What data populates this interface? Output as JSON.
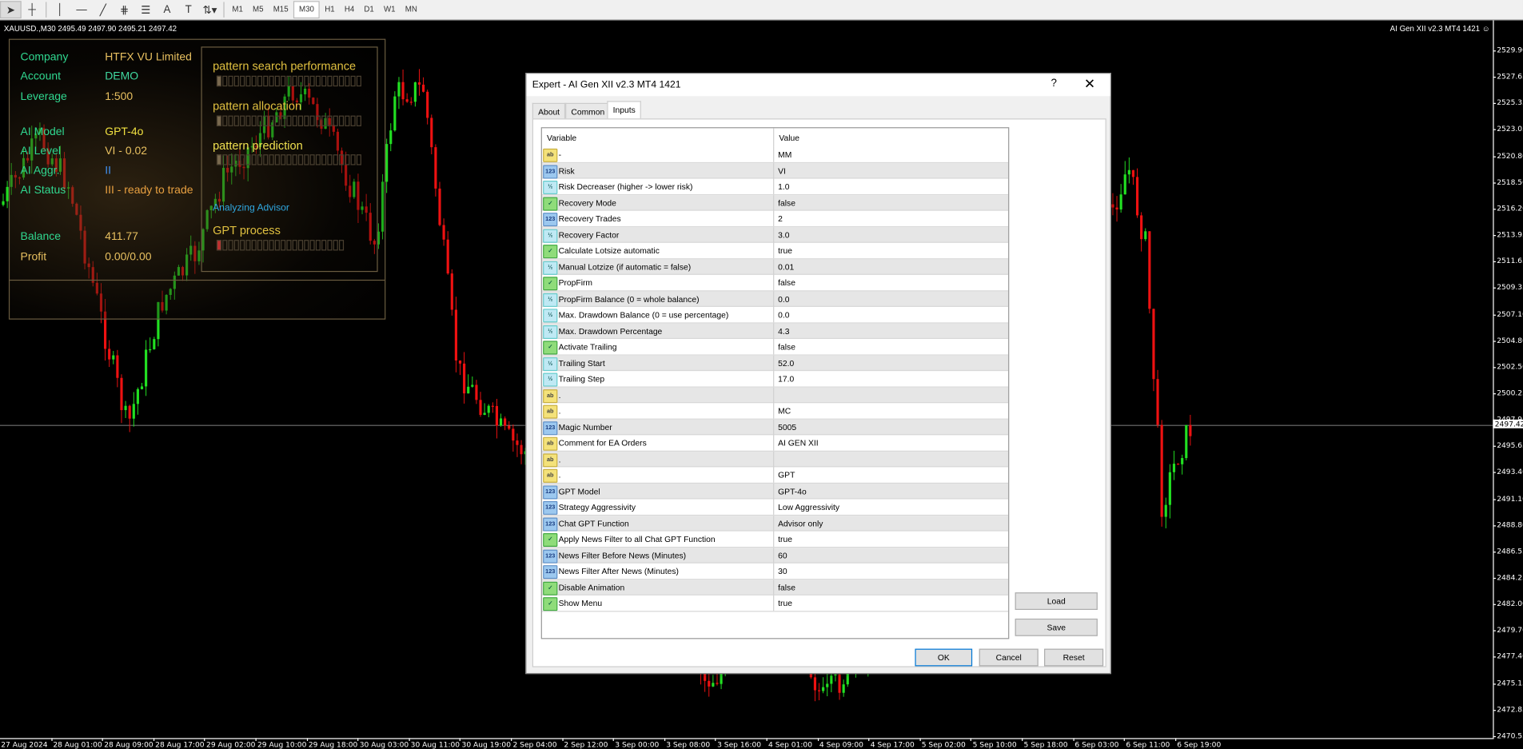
{
  "toolbar": {
    "tools": [
      "cursor-icon",
      "crosshair-icon",
      "vertical-line-icon",
      "horizontal-line-icon",
      "trendline-icon",
      "fibonacci-icon",
      "fibo-fan-icon",
      "text-icon",
      "text-label-icon",
      "arrows-icon"
    ],
    "timeframes": [
      "M1",
      "M5",
      "M15",
      "M30",
      "H1",
      "H4",
      "D1",
      "W1",
      "MN"
    ],
    "active_timeframe": "M30"
  },
  "chart": {
    "symbol_line": "XAUUSD.,M30  2495.49 2497.90 2495.21 2497.42",
    "ea_name": "AI Gen XII v2.3 MT4 1421 ☺",
    "current_price": "2497.42",
    "colors": {
      "bull": "#22e022",
      "bear": "#ee1111",
      "background": "#000000"
    },
    "price_labels": [
      "2529.90",
      "2527.65",
      "2525.35",
      "2523.05",
      "2520.80",
      "2518.50",
      "2516.20",
      "2513.95",
      "2511.65",
      "2509.35",
      "2507.10",
      "2504.80",
      "2502.50",
      "2500.25",
      "2497.95",
      "2495.65",
      "2493.40",
      "2491.10",
      "2488.80",
      "2486.55",
      "2484.25",
      "2482.00",
      "2479.70",
      "2477.40",
      "2475.15",
      "2472.85",
      "2470.55"
    ],
    "time_labels": [
      "27 Aug 2024",
      "28 Aug 01:00",
      "28 Aug 09:00",
      "28 Aug 17:00",
      "29 Aug 02:00",
      "29 Aug 10:00",
      "29 Aug 18:00",
      "30 Aug 03:00",
      "30 Aug 11:00",
      "30 Aug 19:00",
      "2 Sep 04:00",
      "2 Sep 12:00",
      "3 Sep 00:00",
      "3 Sep 08:00",
      "3 Sep 16:00",
      "4 Sep 01:00",
      "4 Sep 09:00",
      "4 Sep 17:00",
      "5 Sep 02:00",
      "5 Sep 10:00",
      "5 Sep 18:00",
      "6 Sep 03:00",
      "6 Sep 11:00",
      "6 Sep 19:00"
    ]
  },
  "overlay": {
    "info": [
      {
        "label": "Company",
        "value": "HTFX VU Limited",
        "vcolor": "#e8c060"
      },
      {
        "label": "Account",
        "value": "DEMO",
        "vcolor": "#40d8a0"
      },
      {
        "label": "Leverage",
        "value": "1:500",
        "vcolor": "#e8c060"
      },
      {
        "label": "AI Model",
        "value": "GPT-4o",
        "vcolor": "#f0e040"
      },
      {
        "label": "AI Level",
        "value": "VI - 0.02",
        "vcolor": "#e8c060"
      },
      {
        "label": "AI Aggr.",
        "value": "II",
        "vcolor": "#4090f0"
      },
      {
        "label": "AI Status",
        "value": "III - ready to trade",
        "vcolor": "#e8a040"
      },
      {
        "label": "Balance",
        "value": "411.77",
        "vcolor": "#e8c060"
      },
      {
        "label": "Profit",
        "value": "0.00/0.00",
        "vcolor": "#e8c060",
        "lcolor": "#e8c060"
      }
    ],
    "pattern_search": "pattern search performance",
    "pattern_allocation": "pattern allocation",
    "pattern_prediction": "pattern prediction",
    "analyzing": "Analyzing Advisor",
    "gpt_process": "GPT process",
    "progress": {
      "pattern_search": 0.04,
      "pattern_allocation": 0.04,
      "pattern_prediction": 0.04,
      "gpt_process": 0.04
    }
  },
  "dialog": {
    "title": "Expert - AI Gen XII v2.3 MT4 1421",
    "help": "?",
    "close": "✕",
    "tabs": [
      "About",
      "Common",
      "Inputs"
    ],
    "active_tab": "Inputs",
    "columns": [
      "Variable",
      "Value"
    ],
    "rows": [
      {
        "t": "ab",
        "name": "-",
        "value": " MM"
      },
      {
        "t": "int",
        "name": "Risk",
        "value": "VI"
      },
      {
        "t": "dbl",
        "name": "Risk Decreaser (higher -> lower risk)",
        "value": "1.0"
      },
      {
        "t": "bool",
        "name": "Recovery Mode",
        "value": "false"
      },
      {
        "t": "int",
        "name": "Recovery Trades",
        "value": "2"
      },
      {
        "t": "dbl",
        "name": "Recovery Factor",
        "value": "3.0"
      },
      {
        "t": "bool",
        "name": "Calculate Lotsize automatic",
        "value": "true"
      },
      {
        "t": "dbl",
        "name": "Manual Lotzize (if automatic = false)",
        "value": "0.01"
      },
      {
        "t": "bool",
        "name": "PropFirm",
        "value": "false"
      },
      {
        "t": "dbl",
        "name": "PropFirm Balance (0 = whole balance)",
        "value": "0.0"
      },
      {
        "t": "dbl",
        "name": "Max. Drawdown Balance (0 = use percentage)",
        "value": "0.0"
      },
      {
        "t": "dbl",
        "name": "Max. Drawdown Percentage",
        "value": "4.3"
      },
      {
        "t": "bool",
        "name": "Activate Trailing",
        "value": "false"
      },
      {
        "t": "dbl",
        "name": "Trailing Start",
        "value": "52.0"
      },
      {
        "t": "dbl",
        "name": "Trailing Step",
        "value": "17.0"
      },
      {
        "t": "ab",
        "name": ".",
        "value": ""
      },
      {
        "t": "ab",
        "name": ".",
        "value": " MC"
      },
      {
        "t": "int",
        "name": "Magic Number",
        "value": "5005"
      },
      {
        "t": "ab",
        "name": "Comment for EA Orders",
        "value": "AI GEN XII"
      },
      {
        "t": "ab",
        "name": ".",
        "value": ""
      },
      {
        "t": "ab",
        "name": ".",
        "value": " GPT"
      },
      {
        "t": "int",
        "name": "GPT Model",
        "value": "GPT-4o"
      },
      {
        "t": "int",
        "name": "Strategy Aggressivity",
        "value": "Low Aggressivity"
      },
      {
        "t": "int",
        "name": "Chat GPT Function",
        "value": "Advisor only"
      },
      {
        "t": "bool",
        "name": "Apply News Filter to all Chat GPT Function",
        "value": "true"
      },
      {
        "t": "int",
        "name": "News Filter Before News (Minutes)",
        "value": "60"
      },
      {
        "t": "int",
        "name": "News Filter After News (Minutes)",
        "value": "30"
      },
      {
        "t": "bool",
        "name": "Disable Animation",
        "value": "false"
      },
      {
        "t": "bool",
        "name": "Show Menu",
        "value": "true"
      }
    ],
    "icon_text": {
      "ab": "ab",
      "int": "123",
      "dbl": "½",
      "bool": "✓"
    },
    "buttons": {
      "load": "Load",
      "save": "Save",
      "ok": "OK",
      "cancel": "Cancel",
      "reset": "Reset"
    }
  }
}
